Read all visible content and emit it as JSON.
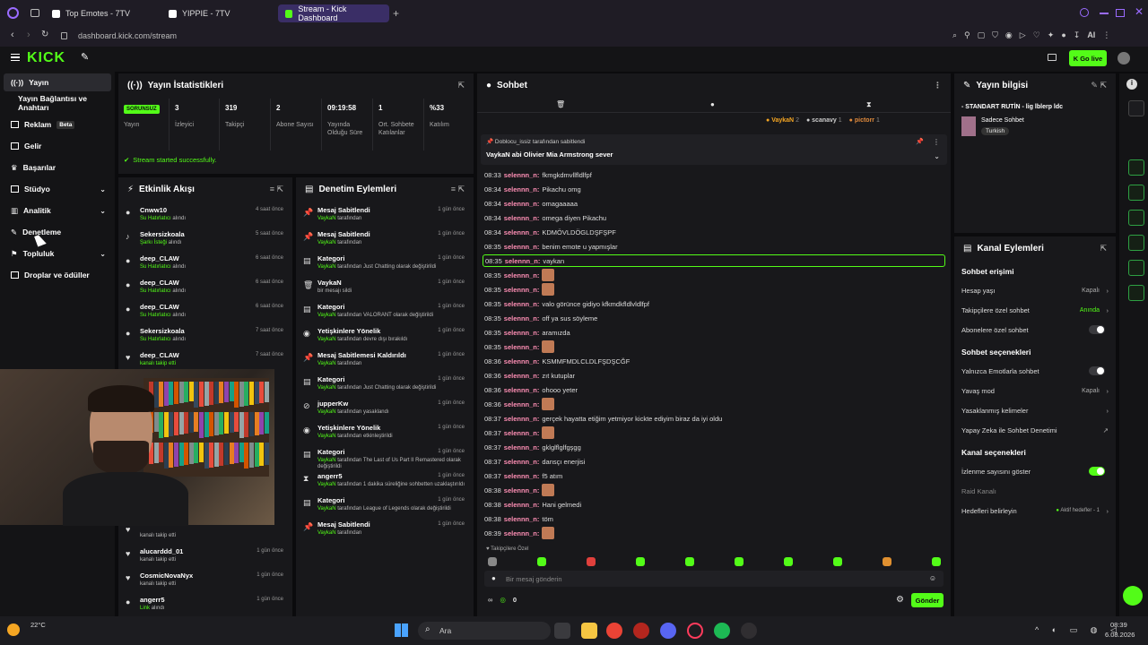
{
  "browser": {
    "tabs": [
      {
        "title": "Top Emotes - 7TV"
      },
      {
        "title": "YIPPIE - 7TV"
      },
      {
        "title": "Stream - Kick Dashboard"
      }
    ],
    "url": "dashboard.kick.com/stream",
    "ext_label": "AI"
  },
  "header": {
    "logo": "KICK",
    "go_live": "Go live"
  },
  "sidebar": {
    "items": [
      {
        "label": "Yayın"
      },
      {
        "label": "Yayın Bağlantısı ve Anahtarı"
      },
      {
        "label": "Reklam",
        "badge": "Beta"
      },
      {
        "label": "Gelir"
      },
      {
        "label": "Başarılar"
      },
      {
        "label": "Stüdyo"
      },
      {
        "label": "Analitik"
      },
      {
        "label": "Denetleme"
      },
      {
        "label": "Topluluk"
      },
      {
        "label": "Droplar ve ödüller"
      }
    ]
  },
  "stats": {
    "title": "Yayın İstatistikleri",
    "badge": "SORUNSUZ",
    "items": [
      {
        "value": "",
        "label": "Yayın"
      },
      {
        "value": "3",
        "label": "İzleyici"
      },
      {
        "value": "319",
        "label": "Takipçi"
      },
      {
        "value": "2",
        "label": "Abone Sayısı"
      },
      {
        "value": "09:19:58",
        "label": "Yayında Olduğu Süre"
      },
      {
        "value": "1",
        "label": "Ort. Sohbete Katılanlar"
      },
      {
        "value": "%33",
        "label": "Katılım"
      }
    ],
    "status_msg": "Stream started successfully."
  },
  "activity": {
    "title": "Etkinlik Akışı",
    "rows": [
      {
        "name": "Cnww10",
        "sub": "Su Hatırlatıcı",
        "sub2": "alındı",
        "time": "4 saat önce"
      },
      {
        "name": "Sekersizkoala",
        "sub": "Şarkı İsteği",
        "sub2": "alındı",
        "time": "5 saat önce"
      },
      {
        "name": "deep_CLAW",
        "sub": "Su Hatırlatıcı",
        "sub2": "alındı",
        "time": "6 saat önce"
      },
      {
        "name": "deep_CLAW",
        "sub": "Su Hatırlatıcı",
        "sub2": "alındı",
        "time": "6 saat önce"
      },
      {
        "name": "deep_CLAW",
        "sub": "Su Hatırlatıcı",
        "sub2": "alındı",
        "time": "6 saat önce"
      },
      {
        "name": "Sekersizkoala",
        "sub": "Su Hatırlatıcı",
        "sub2": "alındı",
        "time": "7 saat önce"
      },
      {
        "name": "deep_CLAW",
        "sub": "kanalı takip etti",
        "sub2": "",
        "time": "7 saat önce"
      }
    ],
    "bottom_rows": [
      {
        "name": "",
        "sub": "kanalı takip etti",
        "sub2": "",
        "time": ""
      },
      {
        "name": "alucarddd_01",
        "sub": "kanalı takip etti",
        "sub2": "",
        "time": "1 gün önce"
      },
      {
        "name": "CosmicNovaNyx",
        "sub": "kanalı takip etti",
        "sub2": "",
        "time": "1 gün önce"
      },
      {
        "name": "angerr5",
        "sub": "Link",
        "sub2": "alındı",
        "time": "1 gün önce"
      }
    ]
  },
  "moderation": {
    "title": "Denetim Eylemleri",
    "rows": [
      {
        "name": "Mesaj Sabitlendi",
        "actor": "VaykaN",
        "rest": "tarafından",
        "time": "1 gün önce"
      },
      {
        "name": "Mesaj Sabitlendi",
        "actor": "VaykaN",
        "rest": "tarafından",
        "time": "1 gün önce"
      },
      {
        "name": "Kategori",
        "actor": "VaykaN",
        "rest": "tarafından Just Chatting olarak değiştirildi",
        "time": "1 gün önce"
      },
      {
        "name": "VaykaN",
        "actor": "",
        "rest": "bir mesajı sildi",
        "time": "1 gün önce"
      },
      {
        "name": "Kategori",
        "actor": "VaykaN",
        "rest": "tarafından VALORANT olarak değiştirildi",
        "time": "1 gün önce"
      },
      {
        "name": "Yetişkinlere Yönelik",
        "actor": "VaykaN",
        "rest": "tarafından devre dışı bırakıldı",
        "time": "1 gün önce"
      },
      {
        "name": "Mesaj Sabitlemesi Kaldırıldı",
        "actor": "VaykaN",
        "rest": "tarafından",
        "time": "1 gün önce"
      },
      {
        "name": "Kategori",
        "actor": "VaykaN",
        "rest": "tarafından Just Chatting olarak değiştirildi",
        "time": "1 gün önce"
      },
      {
        "name": "jupperKw",
        "actor": "VaykaN",
        "rest": "tarafından yasaklandı",
        "time": "1 gün önce"
      },
      {
        "name": "Yetişkinlere Yönelik",
        "actor": "VaykaN",
        "rest": "tarafından etkinleştirildi",
        "time": "1 gün önce"
      },
      {
        "name": "Kategori",
        "actor": "VaykaN",
        "rest": "tarafından The Last of Us Part II Remastered olarak değiştirildi",
        "time": "1 gün önce"
      },
      {
        "name": "angerr5",
        "actor": "VaykaN",
        "rest": "tarafından 1 dakika süreliğine sohbetten uzaklaştırıldı",
        "time": "1 gün önce"
      },
      {
        "name": "Kategori",
        "actor": "VaykaN",
        "rest": "tarafından League of Legends olarak değiştirildi",
        "time": "1 gün önce"
      },
      {
        "name": "Mesaj Sabitlendi",
        "actor": "VaykaN",
        "rest": "tarafından",
        "time": "1 gün önce"
      }
    ]
  },
  "chat": {
    "title": "Sohbet",
    "top_chatters": [
      {
        "name": "VaykaN",
        "count": "2"
      },
      {
        "name": "scanavy",
        "count": "1"
      },
      {
        "name": "pictorr",
        "count": "1"
      }
    ],
    "pinned_by": "Doblocu_issiz tarafından sabitlendi",
    "pinned_msg": "VaykaN abi Olivier Mia Armstrong sever",
    "messages": [
      {
        "time": "08:33",
        "user": "selennn_n:",
        "text": "fkmgkdmvllfldlfpf",
        "emote": false
      },
      {
        "time": "08:34",
        "user": "selennn_n:",
        "text": "Pikachu omg",
        "emote": false
      },
      {
        "time": "08:34",
        "user": "selennn_n:",
        "text": "omagaaaaa",
        "emote": false
      },
      {
        "time": "08:34",
        "user": "selennn_n:",
        "text": "omega diyen Pikachu",
        "emote": false
      },
      {
        "time": "08:34",
        "user": "selennn_n:",
        "text": "KDMÖVLDÖGLDŞFŞPF",
        "emote": false
      },
      {
        "time": "08:35",
        "user": "selennn_n:",
        "text": "benim emote u yapmışlar",
        "emote": false
      },
      {
        "time": "08:35",
        "user": "selennn_n:",
        "text": "vaykan",
        "emote": false
      },
      {
        "time": "08:35",
        "user": "selennn_n:",
        "text": "",
        "emote": true
      },
      {
        "time": "08:35",
        "user": "selennn_n:",
        "text": "",
        "emote": true
      },
      {
        "time": "08:35",
        "user": "selennn_n:",
        "text": "valo görünce gidiyo kfkmdkfldlvldlfpf",
        "emote": false
      },
      {
        "time": "08:35",
        "user": "selennn_n:",
        "text": "off ya sus söyleme",
        "emote": false
      },
      {
        "time": "08:35",
        "user": "selennn_n:",
        "text": "aramızda",
        "emote": false
      },
      {
        "time": "08:35",
        "user": "selennn_n:",
        "text": "",
        "emote": true
      },
      {
        "time": "08:36",
        "user": "selennn_n:",
        "text": "KSMMFMDLCLDLFŞDŞCĞF",
        "emote": false
      },
      {
        "time": "08:36",
        "user": "selennn_n:",
        "text": "zıt kutuplar",
        "emote": false
      },
      {
        "time": "08:36",
        "user": "selennn_n:",
        "text": "ohooo yeter",
        "emote": false
      },
      {
        "time": "08:36",
        "user": "selennn_n:",
        "text": "",
        "emote": true
      },
      {
        "time": "08:37",
        "user": "selennn_n:",
        "text": "gerçek hayatta etiğim yetmiyor kickte ediyim biraz da iyi oldu",
        "emote": false
      },
      {
        "time": "08:37",
        "user": "selennn_n:",
        "text": "",
        "emote": true
      },
      {
        "time": "08:37",
        "user": "selennn_n:",
        "text": "gklglflglfgşgg",
        "emote": false
      },
      {
        "time": "08:37",
        "user": "selennn_n:",
        "text": "dansçı enerjisi",
        "emote": false
      },
      {
        "time": "08:37",
        "user": "selennn_n:",
        "text": "f5 atım",
        "emote": false
      },
      {
        "time": "08:38",
        "user": "selennn_n:",
        "text": "",
        "emote": true
      },
      {
        "time": "08:38",
        "user": "selennn_n:",
        "text": "Hani gelmedi",
        "emote": false
      },
      {
        "time": "08:38",
        "user": "selennn_n:",
        "text": "töm",
        "emote": false
      },
      {
        "time": "08:39",
        "user": "selennn_n:",
        "text": "",
        "emote": true
      }
    ],
    "followers_only": "Takipçilere Özel",
    "input_placeholder": "Bir mesaj gönderin",
    "points": "0",
    "send": "Gönder"
  },
  "stream_info": {
    "title": "Yayın bilgisi",
    "stream_title": "- STANDART RUTİN - lig lblerp ldc",
    "category": "Sadece Sohbet",
    "tag": "Turkish"
  },
  "channel_actions": {
    "title": "Kanal Eylemleri",
    "chat_access": "Sohbet erişimi",
    "account_age": "Hesap yaşı",
    "account_age_val": "Kapalı",
    "followers_chat": "Takipçilere özel sohbet",
    "followers_chat_val": "Anında",
    "subs_chat": "Abonelere özel sohbet",
    "chat_options": "Sohbet seçenekleri",
    "emote_only": "Yalnızca Emotlarla sohbet",
    "slow_mode": "Yavaş mod",
    "slow_mode_val": "Kapalı",
    "banned_words": "Yasaklanmış kelimeler",
    "ai_mod": "Yapay Zeka ile Sohbet Denetimi",
    "channel_options": "Kanal seçenekleri",
    "show_viewers": "İzlenme sayısını göster",
    "raid": "Raid Kanalı",
    "goals": "Hedefleri belirleyin",
    "goals_val": "Aktif hedefler - 1"
  },
  "taskbar": {
    "weather": "22°C",
    "search": "Ara",
    "time": "08:39",
    "date": "6.08.2026"
  },
  "colors": {
    "accent": "#53fc18",
    "tab_active": "#3a2e66",
    "chat_user": "#ff8fb5"
  }
}
